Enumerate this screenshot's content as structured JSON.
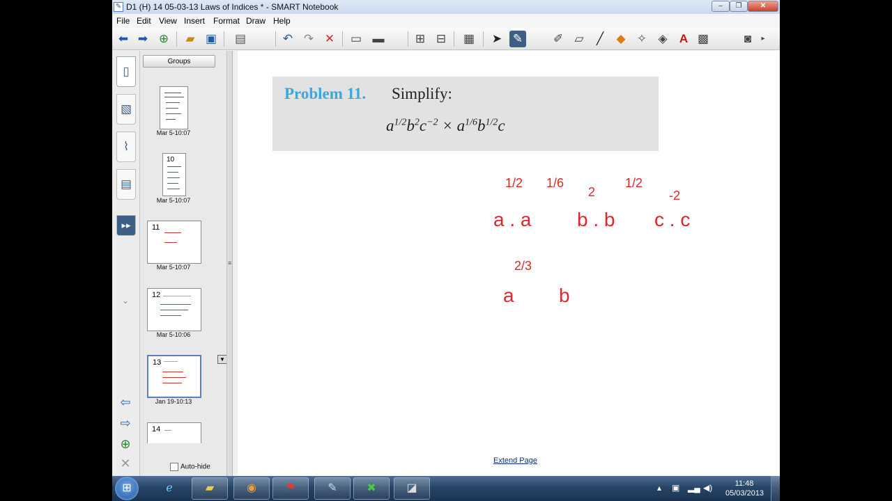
{
  "window": {
    "title": "D1 (H) 14 05-03-13 Laws of Indices * - SMART Notebook",
    "minimize_label": "‒",
    "maximize_label": "❐",
    "close_label": "✕"
  },
  "menu": [
    "File",
    "Edit",
    "View",
    "Insert",
    "Format",
    "Draw",
    "Help"
  ],
  "sidebar": {
    "groups_label": "Groups",
    "thumbnails": [
      {
        "num": "",
        "date": "Mar 5-10:07"
      },
      {
        "num": "10",
        "date": "Mar 5-10:07"
      },
      {
        "num": "11",
        "date": "Mar 5-10:07"
      },
      {
        "num": "12",
        "date": "Mar 5-10:06"
      },
      {
        "num": "13",
        "date": "Jan 19-10:13"
      },
      {
        "num": "14",
        "date": ""
      }
    ],
    "autohide_label": "Auto-hide"
  },
  "page": {
    "problem_label": "Problem 11.",
    "instruction": "Simplify:",
    "expr_parts": [
      "a",
      "1/2",
      "b",
      "2",
      "c",
      "−2",
      " × a",
      "1/6",
      "b",
      "1/2",
      "c"
    ],
    "handwriting": [
      "1/2",
      "1/6",
      "2",
      "1/2",
      "-2",
      "a . a",
      "b . b",
      "c . c",
      "2/3",
      "a",
      "b"
    ],
    "extend_page_label": "Extend Page"
  },
  "taskbar": {
    "time": "11:48",
    "date": "05/03/2013"
  },
  "colors": {
    "problem_label": "#39a8dc",
    "ink": "#e0262b",
    "taskbar": "#274566"
  }
}
